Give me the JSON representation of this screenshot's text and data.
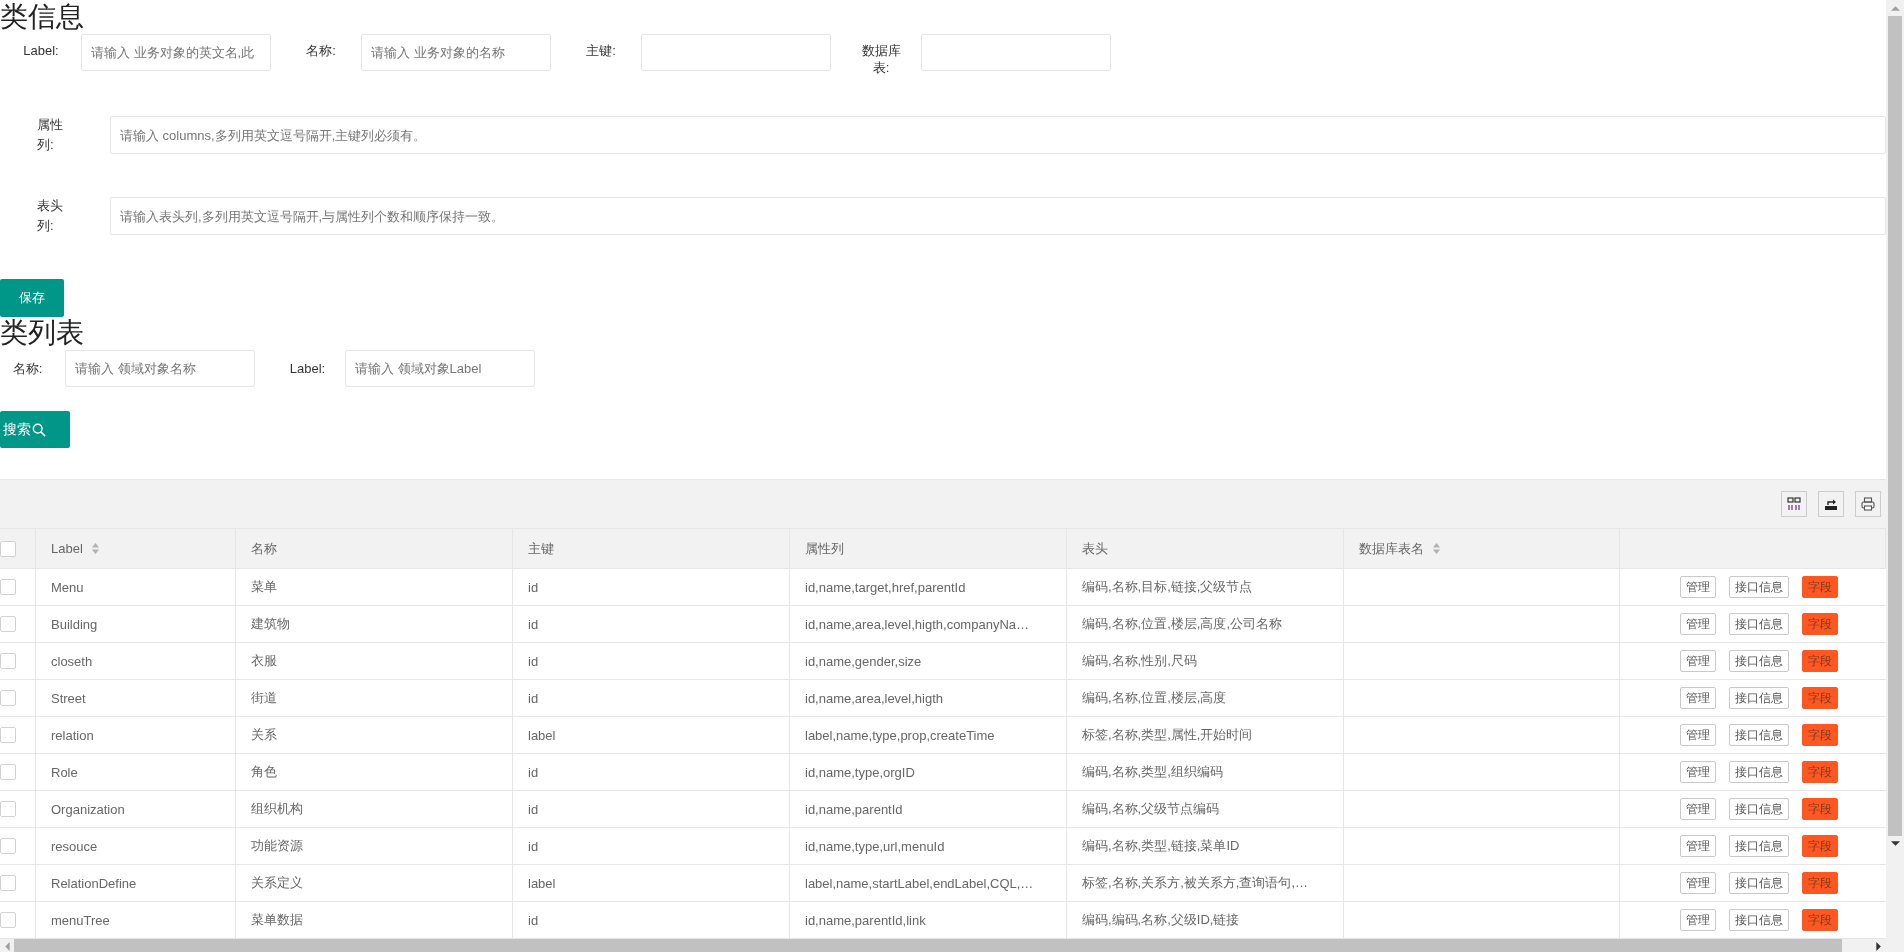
{
  "class_info": {
    "title": "类信息",
    "fields": [
      {
        "label": "Label:",
        "placeholder": "请输入 业务对象的英文名,此"
      },
      {
        "label": "名称:",
        "placeholder": "请输入 业务对象的名称"
      },
      {
        "label": "主键:"
      },
      {
        "label": "数据库表:"
      }
    ],
    "long_fields": [
      {
        "label": "属性列:",
        "placeholder": "请输入 columns,多列用英文逗号隔开,主键列必须有。"
      },
      {
        "label": "表头列:",
        "placeholder": "请输入表头列,多列用英文逗号隔开,与属性列个数和顺序保持一致。"
      }
    ],
    "save_button": "保存"
  },
  "class_list": {
    "title": "类列表",
    "filters": [
      {
        "label": "名称:",
        "placeholder": "请输入 领域对象名称"
      },
      {
        "label": "Label:",
        "placeholder": "请输入 领域对象Label"
      }
    ],
    "search_button": "搜索",
    "table": {
      "header_checked": false,
      "columns": [
        {
          "label": "Label",
          "sortable": true
        },
        {
          "label": "名称",
          "sortable": false
        },
        {
          "label": "主键",
          "sortable": false
        },
        {
          "label": "属性列",
          "sortable": false
        },
        {
          "label": "表头",
          "sortable": false
        },
        {
          "label": "数据库表名",
          "sortable": true
        }
      ],
      "rows": [
        {
          "checked": false,
          "cells": [
            "Menu",
            "菜单",
            "id",
            "id,name,target,href,parentId",
            "编码,名称,目标,链接,父级节点"
          ],
          "actions": [
            {
              "label": "管理",
              "kind": "outline"
            },
            {
              "label": "接口信息",
              "kind": "outline"
            },
            {
              "label": "字段",
              "kind": "warm"
            }
          ]
        },
        {
          "checked": false,
          "cells": [
            "Building",
            "建筑物",
            "id",
            "id,name,area,level,higth,companyNa…",
            "编码,名称,位置,楼层,高度,公司名称"
          ],
          "actions": [
            {
              "label": "管理",
              "kind": "outline"
            },
            {
              "label": "接口信息",
              "kind": "outline"
            },
            {
              "label": "字段",
              "kind": "warm"
            }
          ]
        },
        {
          "checked": false,
          "cells": [
            "closeth",
            "衣服",
            "id",
            "id,name,gender,size",
            "编码,名称,性别,尺码"
          ],
          "actions": [
            {
              "label": "管理",
              "kind": "outline"
            },
            {
              "label": "接口信息",
              "kind": "outline"
            },
            {
              "label": "字段",
              "kind": "warm"
            }
          ]
        },
        {
          "checked": false,
          "cells": [
            "Street",
            "街道",
            "id",
            "id,name,area,level,higth",
            "编码,名称,位置,楼层,高度"
          ],
          "actions": [
            {
              "label": "管理",
              "kind": "outline"
            },
            {
              "label": "接口信息",
              "kind": "outline"
            },
            {
              "label": "字段",
              "kind": "warm"
            }
          ]
        },
        {
          "checked": false,
          "cells": [
            "relation",
            "关系",
            "label",
            "label,name,type,prop,createTime",
            "标签,名称,类型,属性,开始时间"
          ],
          "actions": [
            {
              "label": "管理",
              "kind": "outline"
            },
            {
              "label": "接口信息",
              "kind": "outline"
            },
            {
              "label": "字段",
              "kind": "warm"
            }
          ]
        },
        {
          "checked": false,
          "cells": [
            "Role",
            "角色",
            "id",
            "id,name,type,orgID",
            "编码,名称,类型,组织编码"
          ],
          "actions": [
            {
              "label": "管理",
              "kind": "outline"
            },
            {
              "label": "接口信息",
              "kind": "outline"
            },
            {
              "label": "字段",
              "kind": "warm"
            }
          ]
        },
        {
          "checked": false,
          "cells": [
            "Organization",
            "组织机构",
            "id",
            "id,name,parentId",
            "编码,名称,父级节点编码"
          ],
          "actions": [
            {
              "label": "管理",
              "kind": "outline"
            },
            {
              "label": "接口信息",
              "kind": "outline"
            },
            {
              "label": "字段",
              "kind": "warm"
            }
          ]
        },
        {
          "checked": false,
          "cells": [
            "resouce",
            "功能资源",
            "id",
            "id,name,type,url,menuId",
            "编码,名称,类型,链接,菜单ID"
          ],
          "actions": [
            {
              "label": "管理",
              "kind": "outline"
            },
            {
              "label": "接口信息",
              "kind": "outline"
            },
            {
              "label": "字段",
              "kind": "warm"
            }
          ]
        },
        {
          "checked": false,
          "cells": [
            "RelationDefine",
            "关系定义",
            "label",
            "label,name,startLabel,endLabel,CQL,…",
            "标签,名称,关系方,被关系方,查询语句,…"
          ],
          "actions": [
            {
              "label": "管理",
              "kind": "outline"
            },
            {
              "label": "接口信息",
              "kind": "outline"
            },
            {
              "label": "字段",
              "kind": "warm"
            }
          ]
        },
        {
          "checked": false,
          "cells": [
            "menuTree",
            "菜单数据",
            "id",
            "id,name,parentId,link",
            "编码,编码,名称,父级ID,链接"
          ],
          "actions": [
            {
              "label": "管理",
              "kind": "outline"
            },
            {
              "label": "接口信息",
              "kind": "outline"
            },
            {
              "label": "字段",
              "kind": "warm"
            }
          ]
        }
      ]
    }
  }
}
